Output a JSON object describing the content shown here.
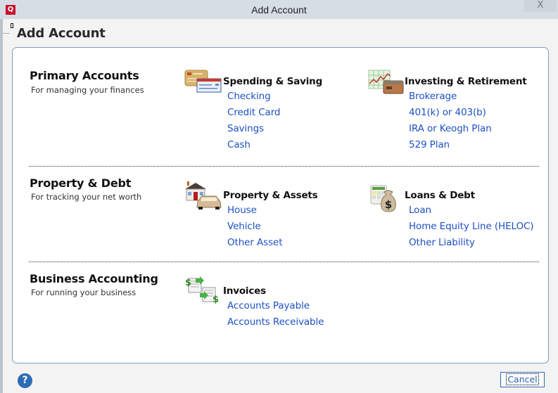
{
  "window": {
    "title": "Add Account",
    "app_icon_letter": "Q",
    "close_glyph": "X"
  },
  "page": {
    "title": "Add Account"
  },
  "sections": [
    {
      "title": "Primary Accounts",
      "subtitle": "For managing your finances",
      "groups": [
        {
          "title": "Spending & Saving",
          "icon": "checkbook-card-icon",
          "links": [
            "Checking",
            "Credit Card",
            "Savings",
            "Cash"
          ]
        },
        {
          "title": "Investing & Retirement",
          "icon": "chart-briefcase-icon",
          "links": [
            "Brokerage",
            "401(k) or 403(b)",
            "IRA or Keogh Plan",
            "529 Plan"
          ]
        }
      ]
    },
    {
      "title": "Property & Debt",
      "subtitle": "For tracking your net worth",
      "groups": [
        {
          "title": "Property & Assets",
          "icon": "house-car-icon",
          "links": [
            "House",
            "Vehicle",
            "Other Asset"
          ]
        },
        {
          "title": "Loans & Debt",
          "icon": "calculator-moneybag-icon",
          "links": [
            "Loan",
            "Home Equity Line (HELOC)",
            "Other Liability"
          ]
        }
      ]
    },
    {
      "title": "Business Accounting",
      "subtitle": "For running your business",
      "groups": [
        {
          "title": "Invoices",
          "icon": "invoices-icon",
          "links": [
            "Accounts Payable",
            "Accounts Receivable"
          ]
        }
      ]
    }
  ],
  "footer": {
    "help_glyph": "?",
    "cancel_label": "Cancel"
  },
  "colors": {
    "link": "#1d50c4",
    "titlebar": "#d6dde5",
    "panel_border": "#7f9db9",
    "brand": "#c8102e",
    "help": "#2b6cb8"
  }
}
